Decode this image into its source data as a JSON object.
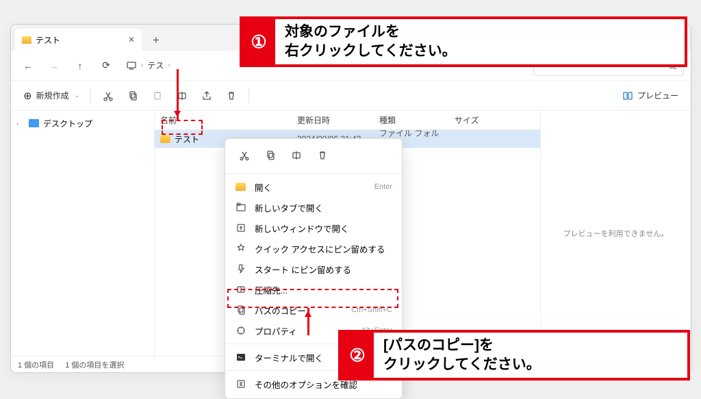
{
  "tab": {
    "title": "テスト"
  },
  "breadcrumb": {
    "item": "テス"
  },
  "toolbar": {
    "new": "新規作成",
    "preview": "プレビュー"
  },
  "sidebar": {
    "desktop": "デスクトップ"
  },
  "columns": {
    "name": "名前",
    "date": "更新日時",
    "type": "種類",
    "size": "サイズ"
  },
  "file": {
    "name": "テスト",
    "date": "2024/09/06 21:43",
    "type": "ファイル フォルダー"
  },
  "preview_msg": "プレビューを利用できません。",
  "status": {
    "count": "1 個の項目",
    "selected": "1 個の項目を選択"
  },
  "ctx": {
    "open": "開く",
    "open_sc": "Enter",
    "newtab": "新しいタブで開く",
    "newwin": "新しいウィンドウで開く",
    "pin_quick": "クイック アクセスにピン留めする",
    "pin_start": "スタート にピン留めする",
    "compress": "圧縮先...",
    "copypath": "パスのコピー",
    "copypath_sc": "Ctrl+Shift+C",
    "properties": "プロパティ",
    "properties_sc": "Alt+Enter",
    "terminal": "ターミナルで開く",
    "more": "その他のオプションを確認"
  },
  "callout1": {
    "num": "①",
    "line1": "対象のファイルを",
    "line2": "右クリックしてください。"
  },
  "callout2": {
    "num": "②",
    "line1": "[パスのコピー]を",
    "line2": "クリックしてください。"
  }
}
